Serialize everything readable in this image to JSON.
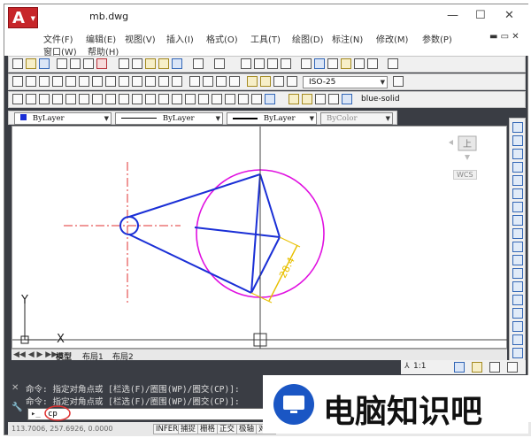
{
  "window": {
    "title": "mb.dwg",
    "minimize": "—",
    "maximize": "☐",
    "close": "✕"
  },
  "menu": [
    "文件(F)",
    "编辑(E)",
    "视图(V)",
    "插入(I)",
    "格式(O)",
    "工具(T)",
    "绘图(D)",
    "标注(N)",
    "修改(M)",
    "参数(P)"
  ],
  "menu2": [
    "窗口(W)",
    "帮助(H)"
  ],
  "styles": {
    "dimstyle": "ISO-25",
    "layer": "blue-solid"
  },
  "properties": {
    "color": "ByLayer",
    "linetype": "ByLayer",
    "lineweight": "ByLayer",
    "plotstyle": "ByColor"
  },
  "viewcube": {
    "face": "上",
    "wcs": "WCS"
  },
  "ucs": {
    "x": "X",
    "y": "Y"
  },
  "drawing": {
    "dimension": "28.4"
  },
  "tabs": [
    "模型",
    "布局1",
    "布局2"
  ],
  "annotation_scale": "1:1",
  "command": {
    "history": [
      "命令: 指定对角点或 [栏选(F)/圈围(WP)/圈交(CP)]:",
      "命令: 指定对角点或 [栏选(F)/圈围(WP)/圈交(CP)]:"
    ],
    "input": "cp"
  },
  "status": {
    "coords": "113.7006, 257.6926, 0.0000",
    "buttons": [
      "INFER",
      "捕捉",
      "栅格",
      "正交",
      "极轴",
      "对象"
    ]
  },
  "watermark": {
    "text": "电脑知识吧"
  },
  "colors": {
    "accent": "#c7262a",
    "blue_line": "#1a2fd6",
    "magenta": "#e010e0",
    "dim": "#e8c000"
  }
}
